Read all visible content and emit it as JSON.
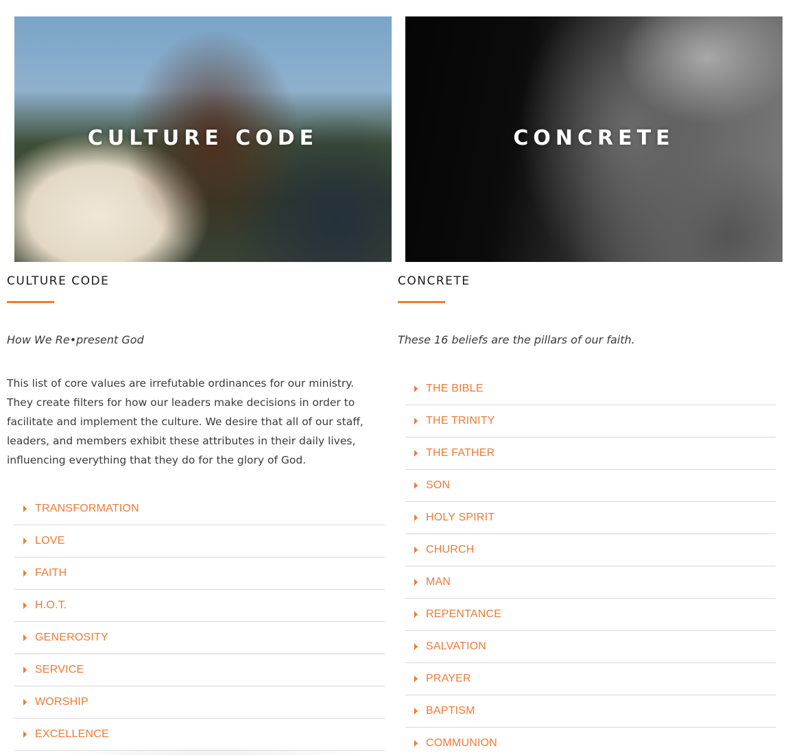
{
  "left": {
    "banner_title": "CULTURE CODE",
    "heading": "CULTURE CODE",
    "tagline": "How We Re•present God",
    "intro": "This list of core values are irrefutable ordinances for our ministry. They create filters for how our leaders make decisions in order to facilitate and implement the culture. We desire that all of our staff, leaders, and members exhibit these attributes in their daily lives, influencing everything that they do for the glory of God.",
    "items": [
      {
        "label": "TRANSFORMATION"
      },
      {
        "label": "LOVE"
      },
      {
        "label": "FAITH"
      },
      {
        "label": "H.O.T."
      },
      {
        "label": "GENEROSITY"
      },
      {
        "label": "SERVICE"
      },
      {
        "label": "WORSHIP"
      },
      {
        "label": "EXCELLENCE"
      }
    ]
  },
  "right": {
    "banner_title": "CONCRETE",
    "heading": "CONCRETE",
    "tagline": "These 16 beliefs are the pillars of our faith.",
    "items": [
      {
        "label": "THE BIBLE"
      },
      {
        "label": "THE TRINITY"
      },
      {
        "label": "THE FATHER"
      },
      {
        "label": "SON"
      },
      {
        "label": "HOLY SPIRIT"
      },
      {
        "label": "CHURCH"
      },
      {
        "label": "MAN"
      },
      {
        "label": "REPENTANCE"
      },
      {
        "label": "SALVATION"
      },
      {
        "label": "PRAYER"
      },
      {
        "label": "BAPTISM"
      },
      {
        "label": "COMMUNION"
      }
    ]
  },
  "colors": {
    "accent": "#f07a34",
    "heading": "#1a1a1a",
    "body_text": "#3a3a3a",
    "divider": "#d8d8d8"
  },
  "icons": {
    "accordion_caret": "caret-right-icon"
  }
}
